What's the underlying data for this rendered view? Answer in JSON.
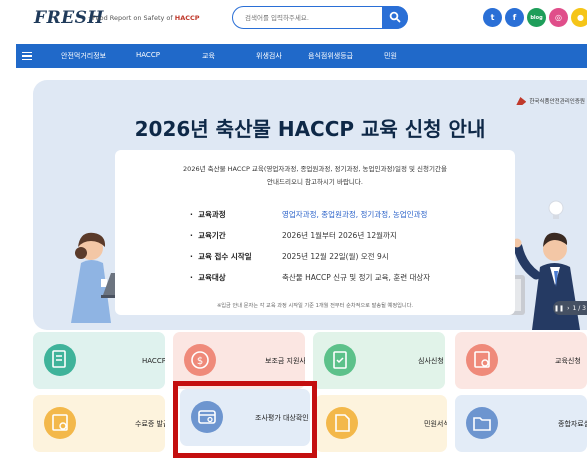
{
  "header": {
    "logo": "FRESH",
    "tagline_prefix": "· Food Report on Safety of ",
    "tagline_highlight": "HACCP",
    "search_placeholder": "검색어를 입력하주세요.",
    "social": [
      {
        "icon": "twitter-icon",
        "glyph": "t",
        "color": "#2a6fd6"
      },
      {
        "icon": "facebook-icon",
        "glyph": "f",
        "color": "#2a6fd6"
      },
      {
        "icon": "blog-icon",
        "glyph": "blog",
        "color": "#1e9e5a"
      },
      {
        "icon": "instagram-icon",
        "glyph": "◎",
        "color": "#e04e8a"
      },
      {
        "icon": "kakao-icon",
        "glyph": "●",
        "color": "#f5c518"
      }
    ]
  },
  "nav": {
    "items": [
      "안전먹거리정보",
      "HACCP",
      "교육",
      "위생검사",
      "음식점위생등급",
      "민원"
    ]
  },
  "banner": {
    "org": "한국식품안전관리인증원",
    "title": "2026년 축산물 HACCP 교육 신청 안내",
    "desc_line1": "2026년 축산물 HACCP 교육(영업자과정, 종업원과정, 정기과정, 농업인과정)일정 및 신청기간을",
    "desc_line2": "안내드리오니 참고하시기 바랍니다.",
    "rows": [
      {
        "label": "교육과정",
        "value": "영업자과정, 종업원과정, 정기과정, 농업인과정"
      },
      {
        "label": "교육기간",
        "value": "2026년 1월부터 2026년 12월까지"
      },
      {
        "label": "교육 접수 시작일",
        "value": "2025년 12월 22일(월) 오전 9시"
      },
      {
        "label": "교육대상",
        "value": "축산물 HACCP 신규 및 정기 교육, 훈련 대상자"
      }
    ],
    "note": "※입금 안내 문자는 각 교육 과정 시작일 기준 1개월 전부터 순차적으로 발송될 예정입니다.",
    "pager": "1 / 3"
  },
  "tiles": [
    {
      "label": "HACCP 인증 업소찾기",
      "bg": "#dff2ee",
      "icon_bg": "#3fb39a",
      "icon": "document-search-icon"
    },
    {
      "label": "보조금 지원사업",
      "bg": "#fbe6e2",
      "icon_bg": "#ef8a7a",
      "icon": "dollar-icon"
    },
    {
      "label": "심사신청",
      "bg": "#e1f3e9",
      "icon_bg": "#5cc18a",
      "icon": "clipboard-icon"
    },
    {
      "label": "교육신청",
      "bg": "#fbe6e2",
      "icon_bg": "#ef8a7a",
      "icon": "certificate-icon"
    },
    {
      "label": "수료증 발급",
      "bg": "#fdf3dd",
      "icon_bg": "#f3b84a",
      "icon": "certificate-icon"
    },
    {
      "label": "조사평가 대상확인",
      "bg": "#e3ecf7",
      "icon_bg": "#6d95cf",
      "icon": "card-search-icon"
    },
    {
      "label": "민원서식",
      "bg": "#fdf3dd",
      "icon_bg": "#f3b84a",
      "icon": "document-icon"
    },
    {
      "label": "종합자료실",
      "bg": "#e3ecf7",
      "icon_bg": "#6d95cf",
      "icon": "folder-icon"
    }
  ]
}
